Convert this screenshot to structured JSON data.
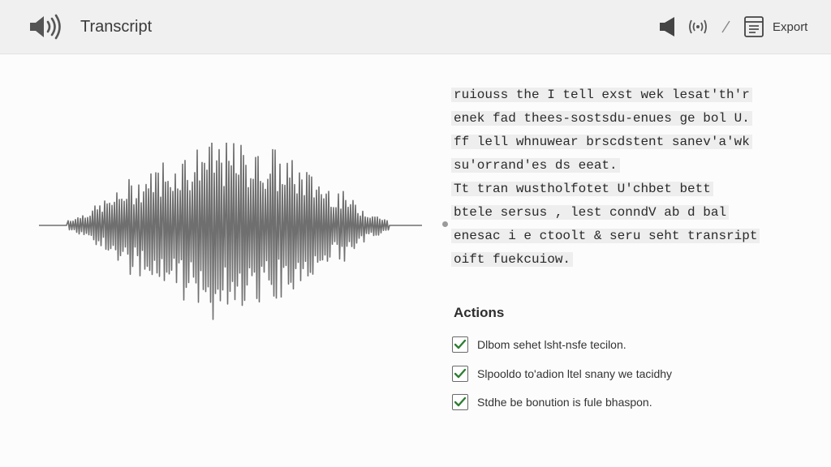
{
  "header": {
    "title": "Transcript",
    "app_icon": "speaker-wave-icon",
    "toolbar": {
      "speaker_icon": "speaker-icon",
      "wave_icon": "sound-waves-icon",
      "export_icon": "export-document-icon",
      "export_label": "Export"
    }
  },
  "waveform": {
    "icon": "audio-waveform"
  },
  "transcript": {
    "lines": [
      "ruiouss the I tell exst wek lesat'th'r",
      "enek fad thees-sostsdu-enues ge bol U.",
      "ff lell whnuwear brscdstent sanev'a'wk",
      "su'orrand'es ds eeat.",
      "Tt tran wustholfotet U'chbet bett",
      "btele sersus , lest conndV ab d bal",
      "enesac i e ctoolt & seru seht transript",
      "oift fuekcuiow."
    ]
  },
  "actions": {
    "heading": "Actions",
    "items": [
      {
        "label": "Dlbom sehet lsht-nsfe tecilon.",
        "checked": true
      },
      {
        "label": "Slpooldo to'adion ltel snany we tacidhy",
        "checked": true
      },
      {
        "label": "Stdhe be bonution is fule bhaspon.",
        "checked": true
      }
    ],
    "check_color": "#2e7d32"
  },
  "colors": {
    "topbar": "#f0f0f0",
    "background": "#fbfbfb",
    "waveform": "#6f6f6f",
    "highlight": "#eeeeee"
  }
}
